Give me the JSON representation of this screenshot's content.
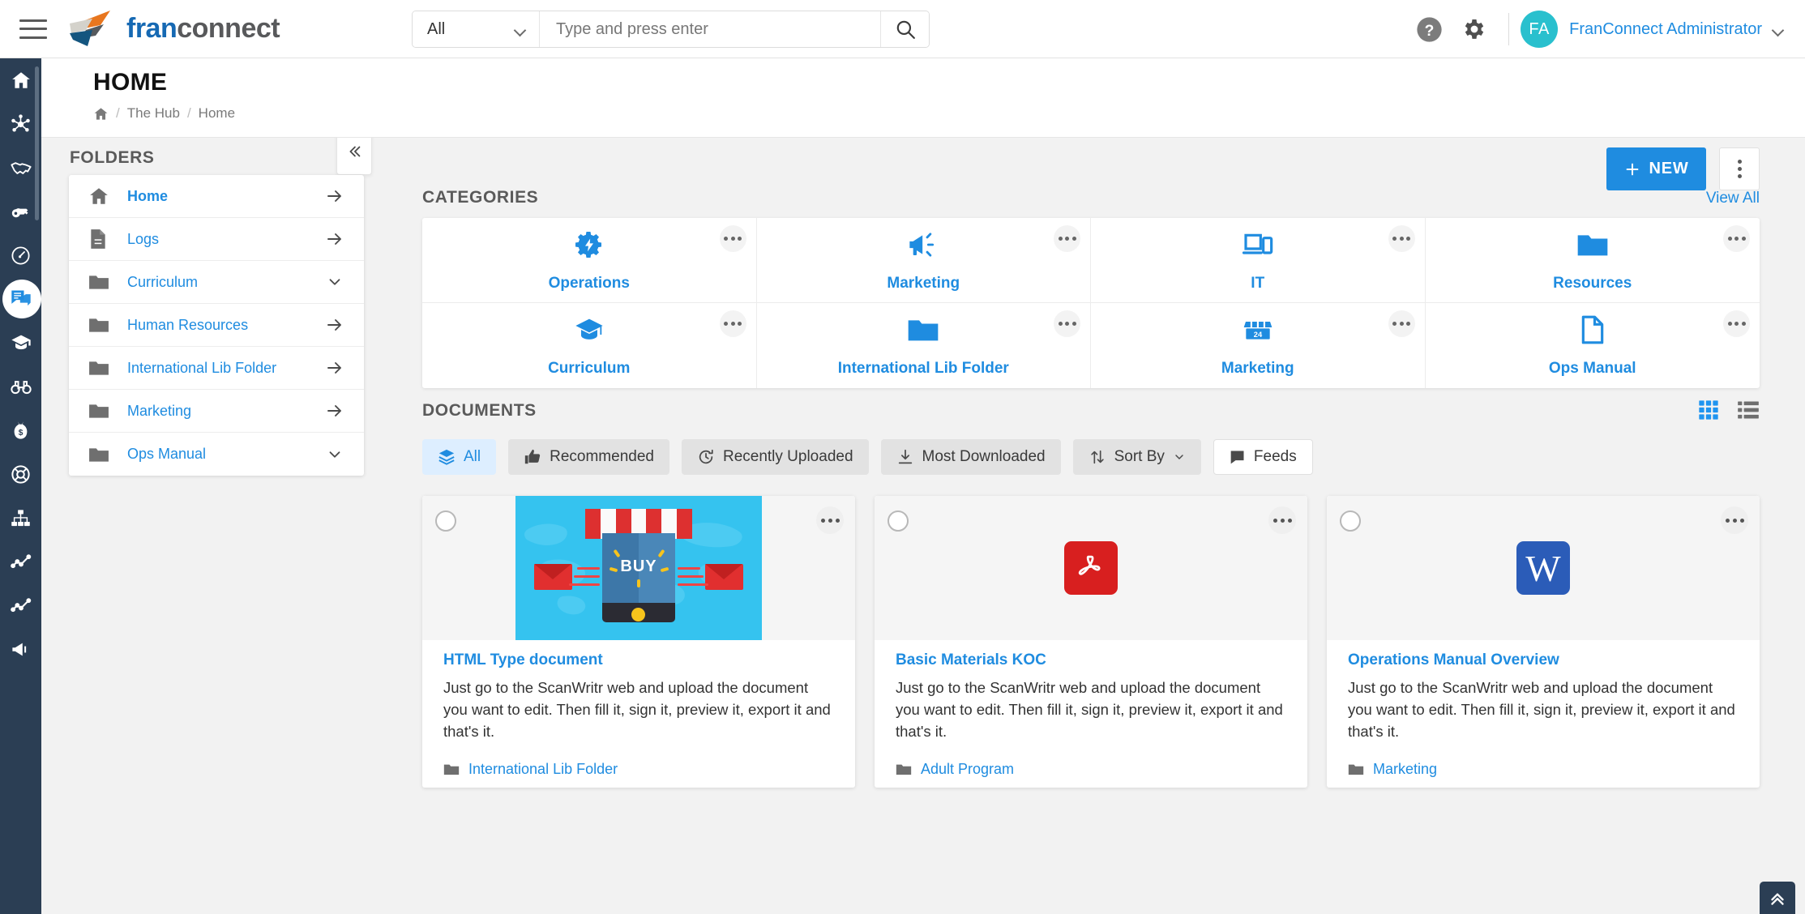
{
  "topbar": {
    "menu_icon": "hamburger-icon",
    "brand_part1": "fran",
    "brand_part2": "connect",
    "search": {
      "scope_value": "All",
      "placeholder": "Type and press enter",
      "value": "",
      "search_icon": "search-icon"
    },
    "help_icon": "help-circle-icon",
    "settings_icon": "gear-icon",
    "avatar_initials": "FA",
    "username": "FranConnect Administrator"
  },
  "leftnav": {
    "items": [
      {
        "icon": "home-icon",
        "active": false
      },
      {
        "icon": "network-hub-icon",
        "active": false
      },
      {
        "icon": "handshake-icon",
        "active": false
      },
      {
        "icon": "key-icon",
        "active": false
      },
      {
        "icon": "speedometer-icon",
        "active": false
      },
      {
        "icon": "hub-chat-icon",
        "active": true
      },
      {
        "icon": "graduation-cap-icon",
        "active": false
      },
      {
        "icon": "binoculars-icon",
        "active": false
      },
      {
        "icon": "money-bag-icon",
        "active": false
      },
      {
        "icon": "life-ring-icon",
        "active": false
      },
      {
        "icon": "org-chart-icon",
        "active": false
      },
      {
        "icon": "line-chart-icon",
        "active": false
      },
      {
        "icon": "line-chart-alt-icon",
        "active": false
      },
      {
        "icon": "megaphone-icon",
        "active": false
      }
    ]
  },
  "page": {
    "title": "HOME",
    "breadcrumb": {
      "home_icon": "home-icon",
      "items": [
        "The Hub",
        "Home"
      ],
      "separator": "/"
    }
  },
  "folders": {
    "heading": "FOLDERS",
    "collapse_icon": "double-chevron-left-icon",
    "items": [
      {
        "label": "Home",
        "icon": "home-icon",
        "action": "arrow-right-icon",
        "bold": true
      },
      {
        "label": "Logs",
        "icon": "document-icon",
        "action": "arrow-right-icon",
        "bold": false
      },
      {
        "label": "Curriculum",
        "icon": "folder-icon",
        "action": "chevron-down-icon",
        "bold": false
      },
      {
        "label": "Human Resources",
        "icon": "folder-icon",
        "action": "arrow-right-icon",
        "bold": false
      },
      {
        "label": "International Lib Folder",
        "icon": "folder-icon",
        "action": "arrow-right-icon",
        "bold": false
      },
      {
        "label": "Marketing",
        "icon": "folder-icon",
        "action": "arrow-right-icon",
        "bold": false
      },
      {
        "label": "Ops Manual",
        "icon": "folder-icon",
        "action": "chevron-down-icon",
        "bold": false
      }
    ]
  },
  "actions": {
    "new_label": "NEW",
    "new_icon": "plus-icon",
    "kebab_icon": "more-vertical-icon"
  },
  "categories": {
    "heading": "CATEGORIES",
    "view_all": "View All",
    "items": [
      {
        "label": "Operations",
        "icon": "gear-bolt-icon"
      },
      {
        "label": "Marketing",
        "icon": "megaphone-icon"
      },
      {
        "label": "IT",
        "icon": "devices-icon"
      },
      {
        "label": "Resources",
        "icon": "folder-filled-icon"
      },
      {
        "label": "Curriculum",
        "icon": "graduation-cap-icon"
      },
      {
        "label": "International Lib Folder",
        "icon": "folder-filled-icon"
      },
      {
        "label": "Marketing",
        "icon": "storefront-24-icon"
      },
      {
        "label": "Ops Manual",
        "icon": "document-outline-icon"
      }
    ]
  },
  "documents": {
    "heading": "DOCUMENTS",
    "view_grid_icon": "grid-view-icon",
    "view_list_icon": "list-view-icon",
    "active_view": "grid",
    "filters": [
      {
        "label": "All",
        "icon": "layers-icon",
        "active": true,
        "style": "active"
      },
      {
        "label": "Recommended",
        "icon": "thumbs-up-icon",
        "active": false,
        "style": "gray"
      },
      {
        "label": "Recently Uploaded",
        "icon": "clock-refresh-icon",
        "active": false,
        "style": "gray"
      },
      {
        "label": "Most Downloaded",
        "icon": "download-icon",
        "active": false,
        "style": "gray"
      },
      {
        "label": "Sort By",
        "icon": "sort-arrows-icon",
        "active": false,
        "style": "gray",
        "trailing_icon": "chevron-down-icon"
      },
      {
        "label": "Feeds",
        "icon": "feed-square-icon",
        "active": false,
        "style": "white"
      }
    ],
    "cards": [
      {
        "title": "HTML Type document",
        "description": "Just go to the ScanWritr web and upload the document you want to edit. Then fill it, sign it, preview it, export it and that's it.",
        "folder": "International Lib Folder",
        "thumb_type": "hero-ecommerce",
        "thumb_text": "BUY",
        "checkbox_icon": "circle-checkbox-icon",
        "menu_icon": "more-horizontal-icon"
      },
      {
        "title": "Basic Materials KOC",
        "description": "Just go to the ScanWritr web and upload the document you want to edit. Then fill it, sign it, preview it, export it and that's it.",
        "folder": "Adult Program",
        "thumb_type": "pdf",
        "thumb_text": "",
        "checkbox_icon": "circle-checkbox-icon",
        "menu_icon": "more-horizontal-icon"
      },
      {
        "title": "Operations Manual Overview",
        "description": "Just go to the ScanWritr web and upload the document you want to edit. Then fill it, sign it, preview it, export it and that's it.",
        "folder": "Marketing",
        "thumb_type": "word",
        "thumb_text": "W",
        "checkbox_icon": "circle-checkbox-icon",
        "menu_icon": "more-horizontal-icon"
      }
    ]
  },
  "scroll_top": {
    "icon": "double-chevron-up-icon"
  },
  "colors": {
    "accent_blue": "#1f8ce0",
    "nav_dark": "#2b3e54",
    "avatar_teal": "#29c0ce",
    "pdf_red": "#d81f1f",
    "word_blue": "#2b5cb8"
  }
}
